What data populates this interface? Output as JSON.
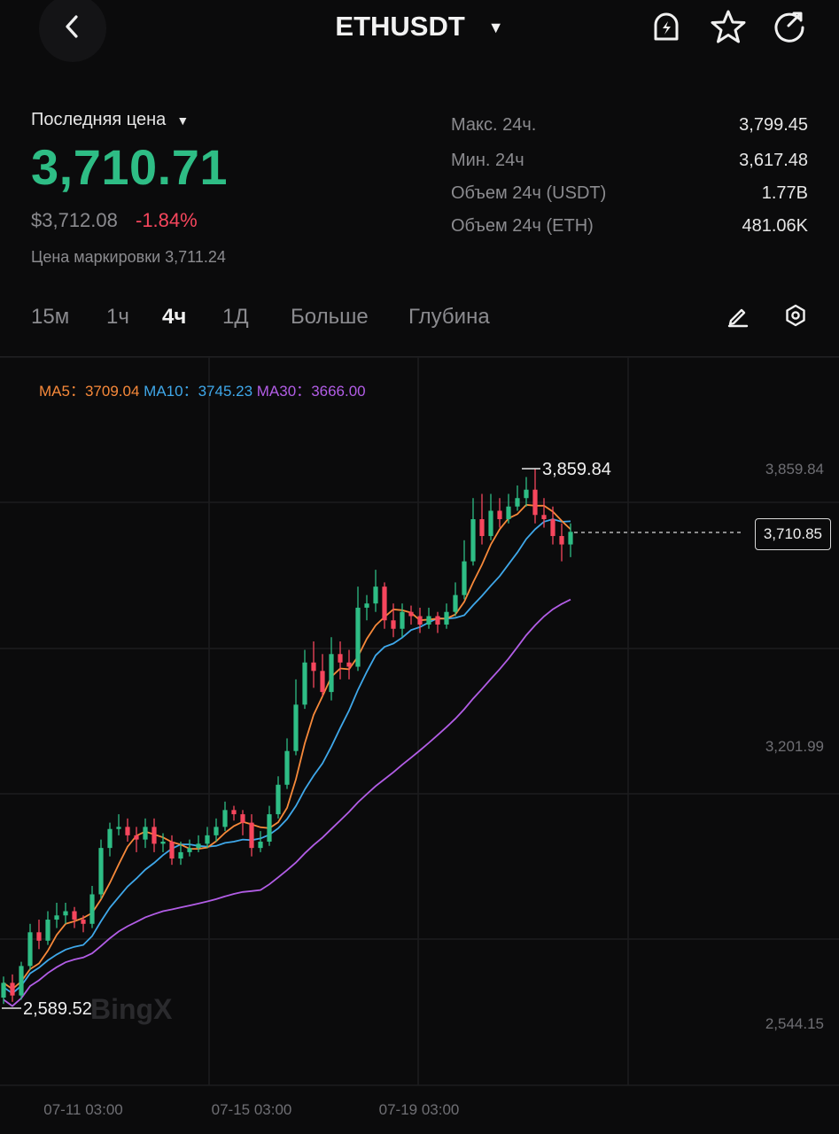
{
  "header": {
    "symbol": "ETHUSDT",
    "back_icon": "chevron-left-icon",
    "alert_icon": "price-alert-bell-icon",
    "favorite_icon": "star-icon",
    "share_icon": "share-icon"
  },
  "price": {
    "label": "Последняя цена",
    "last": "3,710.71",
    "usd": "$3,712.08",
    "change": "-1.84%",
    "mark_label": "Цена маркировки",
    "mark_value": "3,711.24",
    "up_color": "#2ebd85",
    "down_color": "#f6465d"
  },
  "stats": [
    {
      "label": "Макс. 24ч.",
      "value": "3,799.45"
    },
    {
      "label": "Мин. 24ч",
      "value": "3,617.48"
    },
    {
      "label": "Объем 24ч (USDT)",
      "value": "1.77B"
    },
    {
      "label": "Объем 24ч (ETH)",
      "value": "481.06K"
    }
  ],
  "tabs": [
    "15м",
    "1ч",
    "4ч",
    "1Д",
    "Больше",
    "Глубина"
  ],
  "active_tab": "4ч",
  "tools": {
    "draw_icon": "pencil-icon",
    "settings_icon": "hexagon-settings-icon"
  },
  "ma": {
    "ma5_label": "MA5：",
    "ma5_value": "3709.04",
    "ma5_color": "#f7893a",
    "ma10_label": "MA10：",
    "ma10_value": "3745.23",
    "ma10_color": "#3fa8ea",
    "ma30_label": "MA30：",
    "ma30_value": "3666.00",
    "ma30_color": "#b25de6"
  },
  "chart_data": {
    "type": "candlestick",
    "y_axis_labels": [
      "3,859.84",
      "3,201.99",
      "2,544.15"
    ],
    "y_axis_values": [
      3859.84,
      3201.99,
      2544.15
    ],
    "x_axis_labels": [
      "07-11 03:00",
      "07-15 03:00",
      "07-19 03:00"
    ],
    "high_marker": "3,859.84",
    "low_marker": "2,589.52",
    "current_price_tag": "3,710.85",
    "watermark": "BingX",
    "candles": [
      [
        2605,
        2640,
        2590,
        2655
      ],
      [
        2640,
        2610,
        2595,
        2660
      ],
      [
        2610,
        2680,
        2600,
        2690
      ],
      [
        2680,
        2760,
        2670,
        2780
      ],
      [
        2760,
        2740,
        2720,
        2790
      ],
      [
        2740,
        2790,
        2730,
        2810
      ],
      [
        2790,
        2800,
        2770,
        2830
      ],
      [
        2800,
        2810,
        2780,
        2830
      ],
      [
        2810,
        2790,
        2770,
        2820
      ],
      [
        2790,
        2780,
        2760,
        2800
      ],
      [
        2780,
        2850,
        2770,
        2870
      ],
      [
        2850,
        2960,
        2840,
        2980
      ],
      [
        2960,
        3005,
        2940,
        3020
      ],
      [
        3005,
        3010,
        2990,
        3040
      ],
      [
        3010,
        2990,
        2975,
        3030
      ],
      [
        2990,
        2980,
        2950,
        3010
      ],
      [
        2980,
        3010,
        2960,
        3030
      ],
      [
        3010,
        2970,
        2950,
        3030
      ],
      [
        2970,
        2975,
        2950,
        2995
      ],
      [
        2975,
        2935,
        2920,
        2990
      ],
      [
        2935,
        2950,
        2920,
        2975
      ],
      [
        2950,
        2960,
        2940,
        2980
      ],
      [
        2960,
        2970,
        2950,
        2990
      ],
      [
        2970,
        2990,
        2960,
        3010
      ],
      [
        2990,
        3010,
        2975,
        3030
      ],
      [
        3010,
        3050,
        3000,
        3070
      ],
      [
        3050,
        3040,
        3025,
        3060
      ],
      [
        3040,
        3020,
        2990,
        3050
      ],
      [
        3020,
        2960,
        2940,
        3040
      ],
      [
        2960,
        2975,
        2950,
        3000
      ],
      [
        2975,
        3040,
        2965,
        3060
      ],
      [
        3040,
        3110,
        3030,
        3130
      ],
      [
        3110,
        3190,
        3100,
        3220
      ],
      [
        3190,
        3300,
        3180,
        3360
      ],
      [
        3300,
        3400,
        3290,
        3430
      ],
      [
        3400,
        3380,
        3340,
        3450
      ],
      [
        3380,
        3330,
        3320,
        3420
      ],
      [
        3330,
        3420,
        3310,
        3460
      ],
      [
        3420,
        3400,
        3360,
        3450
      ],
      [
        3400,
        3390,
        3360,
        3430
      ],
      [
        3390,
        3530,
        3380,
        3580
      ],
      [
        3530,
        3540,
        3500,
        3560
      ],
      [
        3540,
        3580,
        3520,
        3620
      ],
      [
        3580,
        3500,
        3480,
        3590
      ],
      [
        3500,
        3480,
        3460,
        3540
      ],
      [
        3480,
        3520,
        3460,
        3540
      ],
      [
        3520,
        3510,
        3490,
        3535
      ],
      [
        3510,
        3490,
        3470,
        3530
      ],
      [
        3490,
        3510,
        3480,
        3530
      ],
      [
        3510,
        3490,
        3470,
        3520
      ],
      [
        3490,
        3520,
        3480,
        3540
      ],
      [
        3520,
        3560,
        3510,
        3590
      ],
      [
        3560,
        3640,
        3550,
        3690
      ],
      [
        3640,
        3740,
        3630,
        3790
      ],
      [
        3740,
        3700,
        3680,
        3800
      ],
      [
        3700,
        3760,
        3690,
        3800
      ],
      [
        3760,
        3740,
        3720,
        3790
      ],
      [
        3740,
        3770,
        3730,
        3800
      ],
      [
        3770,
        3790,
        3760,
        3820
      ],
      [
        3790,
        3810,
        3770,
        3840
      ],
      [
        3810,
        3750,
        3730,
        3860
      ],
      [
        3750,
        3740,
        3720,
        3790
      ],
      [
        3740,
        3700,
        3680,
        3770
      ],
      [
        3700,
        3680,
        3640,
        3730
      ],
      [
        3680,
        3710,
        3650,
        3730
      ]
    ]
  }
}
